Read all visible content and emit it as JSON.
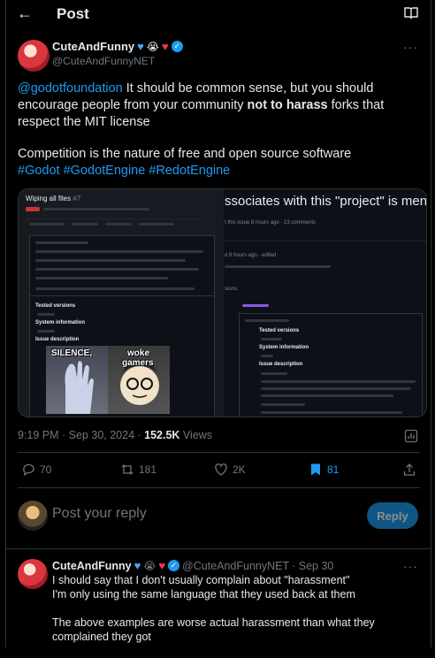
{
  "header": {
    "title": "Post"
  },
  "post": {
    "display_name": "CuteAndFunny",
    "handle": "@CuteAndFunnyNET",
    "mention": "@godotfoundation",
    "text_part1": " It should be common sense, but you should encourage people from your community ",
    "text_bold": "not to harass",
    "text_part2": " forks that respect the MIT license",
    "paragraph2": "Competition is the nature of free and open source software",
    "hashtags": "#Godot #GodotEngine #RedotEngine",
    "time": "9:19 PM · Sep 30, 2024 · ",
    "views_count": "152.5K",
    "views_label": " Views"
  },
  "media": {
    "left_title": "Wiping all files",
    "left_number": "#7",
    "right_headline": "ssociates with this \"project\" is ment",
    "right_sub1": "t this issue 8 hours ago · 13 comments",
    "right_sub2": "d 8 hours ago · edited",
    "right_sub3": "sions.",
    "tested_versions": "Tested versions",
    "system_information": "System information",
    "issue_description": "Issue description",
    "meme_silence": "SILENCE,",
    "meme_woke": "woke",
    "meme_gamers": "gamers"
  },
  "actions": {
    "replies": "70",
    "reposts": "181",
    "likes": "2K",
    "bookmarks": "81"
  },
  "reply_box": {
    "placeholder": "Post your reply",
    "button": "Reply"
  },
  "reply": {
    "display_name": "CuteAndFunny",
    "handle": "@CuteAndFunnyNET",
    "date": " · Sep 30",
    "line1": "I should say that I don't usually complain about \"harassment\"",
    "line2": "I'm only using the same language that they used back at them",
    "line3": "The above examples are worse actual harassment than what they complained they got"
  },
  "colors": {
    "accent": "#1d9bf0",
    "background": "#000000",
    "muted": "#71767b",
    "text": "#e7e9ea"
  },
  "icons": [
    "back-arrow-icon",
    "reader-mode-icon",
    "more-icon",
    "reply-icon",
    "repost-icon",
    "like-icon",
    "bookmark-icon",
    "share-icon",
    "analytics-icon"
  ]
}
